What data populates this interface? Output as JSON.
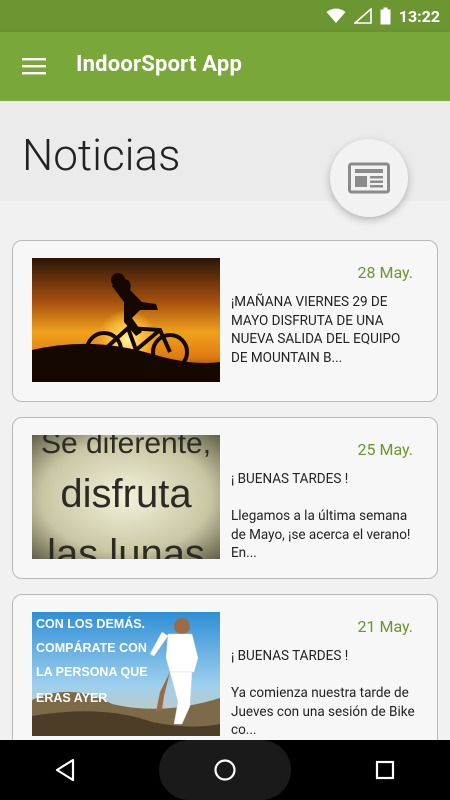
{
  "status": {
    "time": "13:22",
    "icons": [
      "wifi-icon",
      "signal-icon",
      "battery-icon"
    ]
  },
  "app_bar": {
    "title": "IndoorSport App",
    "menu_icon": "menu-icon"
  },
  "header": {
    "title": "Noticias",
    "fab_icon": "newspaper-icon"
  },
  "news": [
    {
      "date": "28 May.",
      "snippet": "¡MAÑANA VIERNES 29 DE MAYO DISFRUTA DE UNA NUEVA SALIDA DEL EQUIPO DE MOUNTAIN B...",
      "image": "mountain-bike-sunset"
    },
    {
      "date": "25 May.",
      "snippet": "¡ BUENAS TARDES !\n\nLlegamos a la última semana de Mayo, ¡se acerca el verano! En...",
      "image": "se-diferente-disfruta-las-lunas"
    },
    {
      "date": "21 May.",
      "snippet": "¡ BUENAS TARDES !\n\nYa comienza nuestra tarde de Jueves con una sesión de Bike co...",
      "image": "runner-motivational"
    }
  ],
  "images": {
    "card2_lines": [
      "Se diferente,",
      "disfruta",
      "las lunas"
    ],
    "card3_lines": [
      "CON LOS DEMÁS.",
      "COMPÁRATE CON",
      "LA PERSONA QUE",
      "ERAS AYER"
    ]
  },
  "colors": {
    "status": "#6b9632",
    "app_bar": "#7aa73a",
    "accent": "#6b9632"
  },
  "nav": [
    "back-icon",
    "home-icon",
    "recents-icon"
  ]
}
